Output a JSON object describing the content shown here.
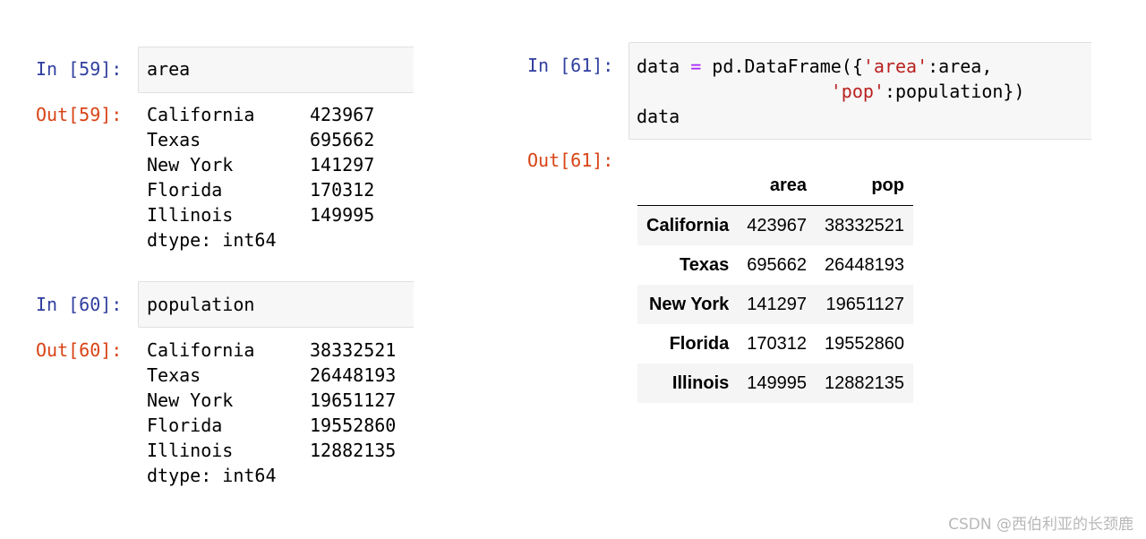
{
  "cells": [
    {
      "in_prompt": "In [59]:",
      "code": "area",
      "out_prompt": "Out[59]:",
      "output": [
        {
          "index": "California",
          "value": "423967"
        },
        {
          "index": "Texas",
          "value": "695662"
        },
        {
          "index": "New York",
          "value": "141297"
        },
        {
          "index": "Florida",
          "value": "170312"
        },
        {
          "index": "Illinois",
          "value": "149995"
        }
      ],
      "dtype": "dtype: int64"
    },
    {
      "in_prompt": "In [60]:",
      "code": "population",
      "out_prompt": "Out[60]:",
      "output": [
        {
          "index": "California",
          "value": "38332521"
        },
        {
          "index": "Texas",
          "value": "26448193"
        },
        {
          "index": "New York",
          "value": "19651127"
        },
        {
          "index": "Florida",
          "value": "19552860"
        },
        {
          "index": "Illinois",
          "value": "12882135"
        }
      ],
      "dtype": "dtype: int64"
    },
    {
      "in_prompt": "In [61]:",
      "code_line1": {
        "a": "data ",
        "op": "=",
        "b": " pd.DataFrame({",
        "s1": "'area'",
        "c": ":area,"
      },
      "code_line2": {
        "indent": "                  ",
        "s2": "'pop'",
        "d": ":population})"
      },
      "code_line3": "data",
      "out_prompt": "Out[61]:",
      "table": {
        "columns": [
          "area",
          "pop"
        ],
        "rows": [
          {
            "index": "California",
            "area": "423967",
            "pop": "38332521"
          },
          {
            "index": "Texas",
            "area": "695662",
            "pop": "26448193"
          },
          {
            "index": "New York",
            "area": "141297",
            "pop": "19651127"
          },
          {
            "index": "Florida",
            "area": "170312",
            "pop": "19552860"
          },
          {
            "index": "Illinois",
            "area": "149995",
            "pop": "12882135"
          }
        ]
      }
    }
  ],
  "watermark": "CSDN @西伯利亚的长颈鹿",
  "colors": {
    "in_prompt": "#303f9f",
    "out_prompt": "#d84315",
    "string": "#ba2121",
    "operator": "#aa22ff",
    "cell_bg": "#f7f7f7"
  }
}
